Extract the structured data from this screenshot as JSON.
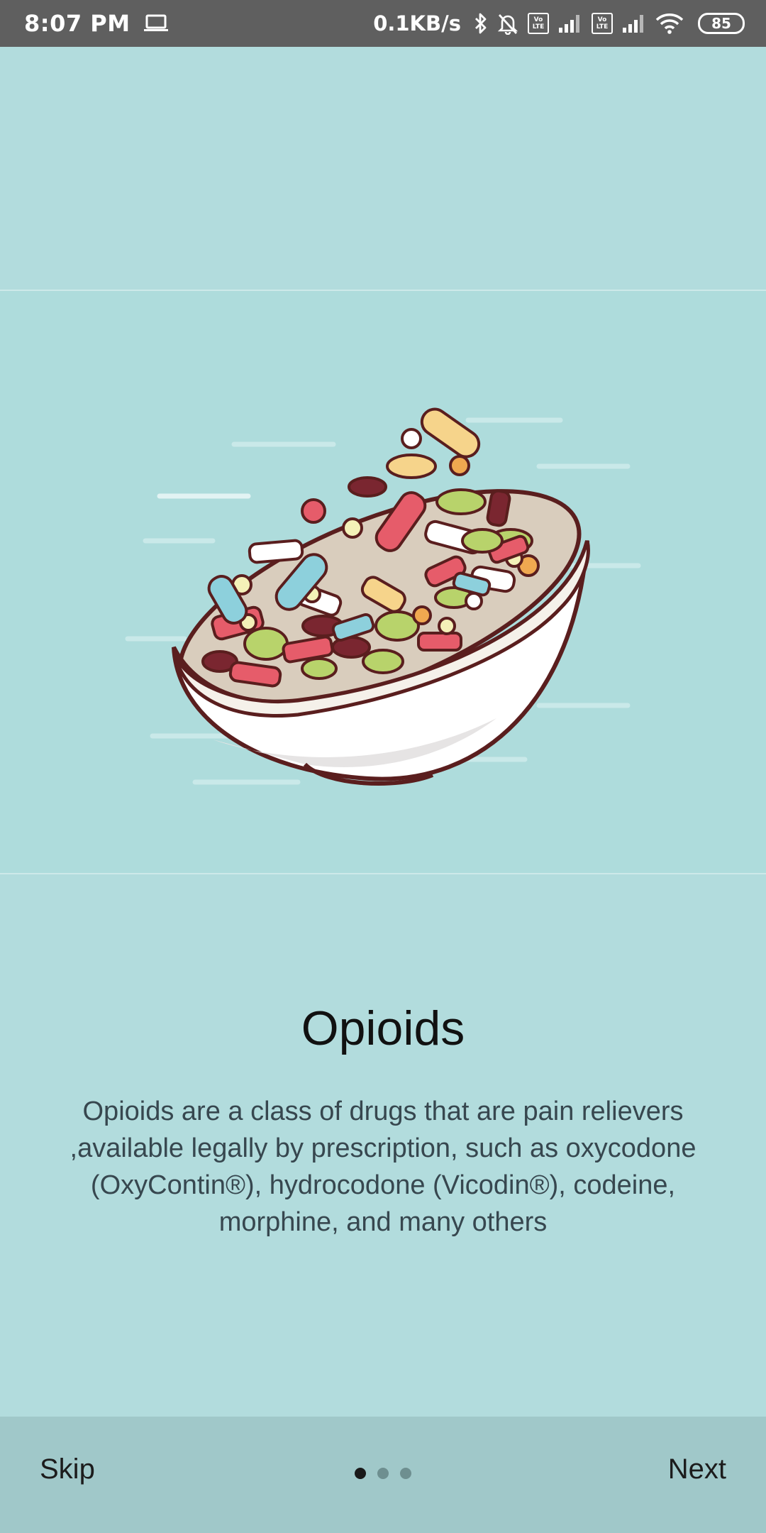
{
  "status_bar": {
    "time": "8:07 PM",
    "net_speed": "0.1KB/s",
    "volte_label_1": "Vo",
    "volte_label_2": "LTE",
    "battery": "85",
    "icons": [
      "laptop-icon",
      "bluetooth-icon",
      "bell-off-icon",
      "volte-icon",
      "signal-icon",
      "wifi-icon",
      "battery-icon"
    ]
  },
  "slide": {
    "illustration": "bowl-of-pills-illustration",
    "title": "Opioids",
    "description": "Opioids are a class of drugs that are pain relievers ,available legally by prescription, such as oxycodone (OxyContin®), hydrocodone (Vicodin®), codeine, morphine, and many others"
  },
  "nav": {
    "skip_label": "Skip",
    "next_label": "Next",
    "pages": 3,
    "current_page": 1
  },
  "colors": {
    "background": "#b2dcdd",
    "status_bar": "#5f5f5f",
    "bottom_bar": "#a0c8c9",
    "bowl_outline": "#5a1e1e"
  }
}
